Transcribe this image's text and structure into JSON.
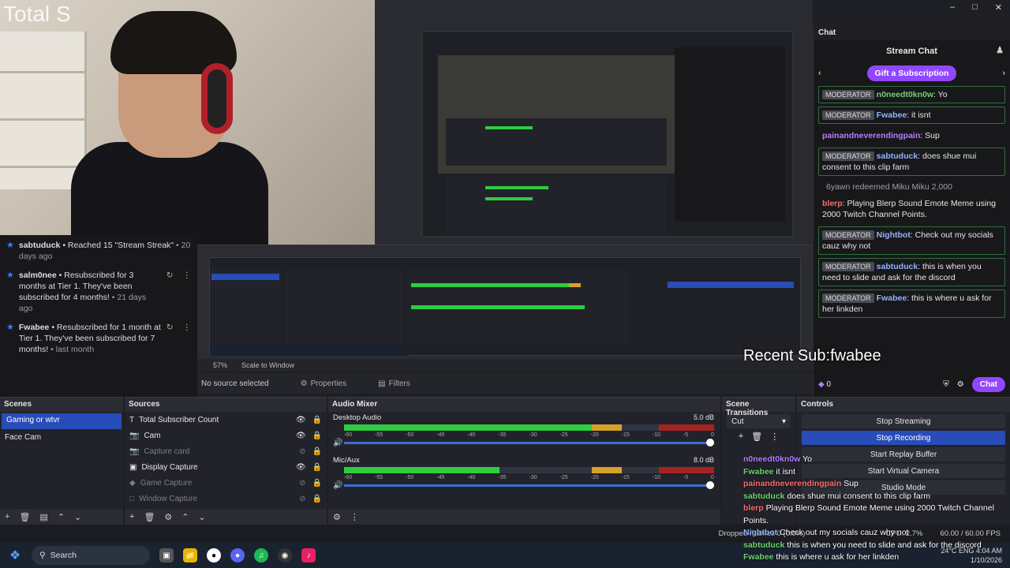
{
  "webcam": {
    "overlay_title": "Total S"
  },
  "activity": {
    "items": [
      {
        "user": "sabtuduck",
        "text": "• Reached 15 \"Stream Streak\"",
        "time": "• 20 days ago"
      },
      {
        "user": "salm0nee",
        "text": "• Resubscribed for 3 months at Tier 1. They've been subscribed for 4 months!",
        "time": "• 21 days ago"
      },
      {
        "user": "Fwabee",
        "text": "• Resubscribed for 1 month at Tier 1. They've been subscribed for 7 months!",
        "time": "• last month"
      }
    ]
  },
  "preview": {
    "zoom": "57%",
    "scale": "Scale to Window",
    "no_source": "No source selected",
    "properties": "Properties",
    "filters": "Filters"
  },
  "chat": {
    "panel_title": "Chat",
    "title": "Stream Chat",
    "gift_label": "Gift a Subscription",
    "messages": [
      {
        "mod": "MODERATOR",
        "user": "n0needt0kn0w",
        "color": "green",
        "text": ": Yo"
      },
      {
        "mod": "MODERATOR",
        "user": "Fwabee",
        "color": "blue",
        "text": ": it isnt"
      },
      {
        "mod": "",
        "user": "painandneverendingpain",
        "color": "purple",
        "text": ": Sup"
      },
      {
        "mod": "MODERATOR",
        "user": "sabtuduck",
        "color": "blue",
        "text": ": does shue mui consent to this clip farm"
      }
    ],
    "redeem": "6yawn redeemed Miku Miku   2,000",
    "messages2": [
      {
        "mod": "",
        "user": "blerp",
        "color": "red",
        "text": ": Playing Blerp Sound Emote Meme using 2000 Twitch Channel Points."
      },
      {
        "mod": "MODERATOR",
        "user": "Nightbot",
        "color": "blue",
        "text": ": Check out my socials cauz why not"
      },
      {
        "mod": "MODERATOR",
        "user": "sabtuduck",
        "color": "blue",
        "text": ": this is when you need to slide and ask for the discord"
      },
      {
        "mod": "MODERATOR",
        "user": "Fwabee",
        "color": "blue",
        "text": ": this is where u ask for her linkden"
      }
    ],
    "recent_sub": "Recent Sub:fwabee",
    "points": "0",
    "chat_button": "Chat"
  },
  "scenes": {
    "title": "Scenes",
    "items": [
      "Gaming or wtvr",
      "Face Cam"
    ]
  },
  "sources": {
    "title": "Sources",
    "items": [
      {
        "icon": "text-icon",
        "name": "Total Subscriber Count",
        "enabled": true
      },
      {
        "icon": "camera-icon",
        "name": "Cam",
        "enabled": true
      },
      {
        "icon": "camera-icon",
        "name": "Capture card",
        "enabled": false
      },
      {
        "icon": "monitor-icon",
        "name": "Display Capture",
        "enabled": true
      },
      {
        "icon": "gamepad-icon",
        "name": "Game Capture",
        "enabled": false
      },
      {
        "icon": "window-icon",
        "name": "Window Capture",
        "enabled": false
      }
    ]
  },
  "mixer": {
    "title": "Audio Mixer",
    "channels": [
      {
        "name": "Desktop Audio",
        "db": "5.0 dB",
        "level": 0.72
      },
      {
        "name": "Mic/Aux",
        "db": "8.0 dB",
        "level": 0.42
      }
    ],
    "ticks": [
      "-60",
      "-55",
      "-50",
      "-45",
      "-40",
      "-35",
      "-30",
      "-25",
      "-20",
      "-15",
      "-10",
      "-5",
      "0"
    ]
  },
  "transitions": {
    "title": "Scene Transitions",
    "selected": "Cut"
  },
  "controls": {
    "title": "Controls",
    "buttons": [
      "Stop Streaming",
      "Stop Recording",
      "Start Replay Buffer",
      "Start Virtual Camera",
      "Studio Mode"
    ]
  },
  "bottom_chat": [
    {
      "user": "n0needt0kn0w",
      "text": " Yo"
    },
    {
      "user": "Fwabee",
      "text": " it isnt"
    },
    {
      "user": "painandneverendingpain",
      "text": " Sup"
    },
    {
      "user": "sabtuduck",
      "text": " does shue mui consent to this clip farm"
    },
    {
      "user": "blerp",
      "text": " Playing Blerp Sound Emote Meme using 2000 Twitch Channel Points."
    },
    {
      "user": "Nightbot",
      "text": " Check out my socials cauz why not"
    },
    {
      "user": "sabtuduck",
      "text": " this is when you need to slide and ask for the discord"
    },
    {
      "user": "Fwabee",
      "text": " this is where u ask for her linkden"
    }
  ],
  "status": {
    "dropped": "Dropped Frames 0 (0.0%)",
    "cpu": "CPU: 2.7%",
    "fps": "60.00 / 60.00 FPS"
  },
  "taskbar": {
    "search": "Search",
    "time": "4:04 AM",
    "date": "1/10/2026",
    "weather": "24°C",
    "lang": "ENG"
  },
  "colors": {
    "accent": "#9147ff",
    "obs_blue": "#284cb8",
    "meter_green": "#2ecc40"
  }
}
